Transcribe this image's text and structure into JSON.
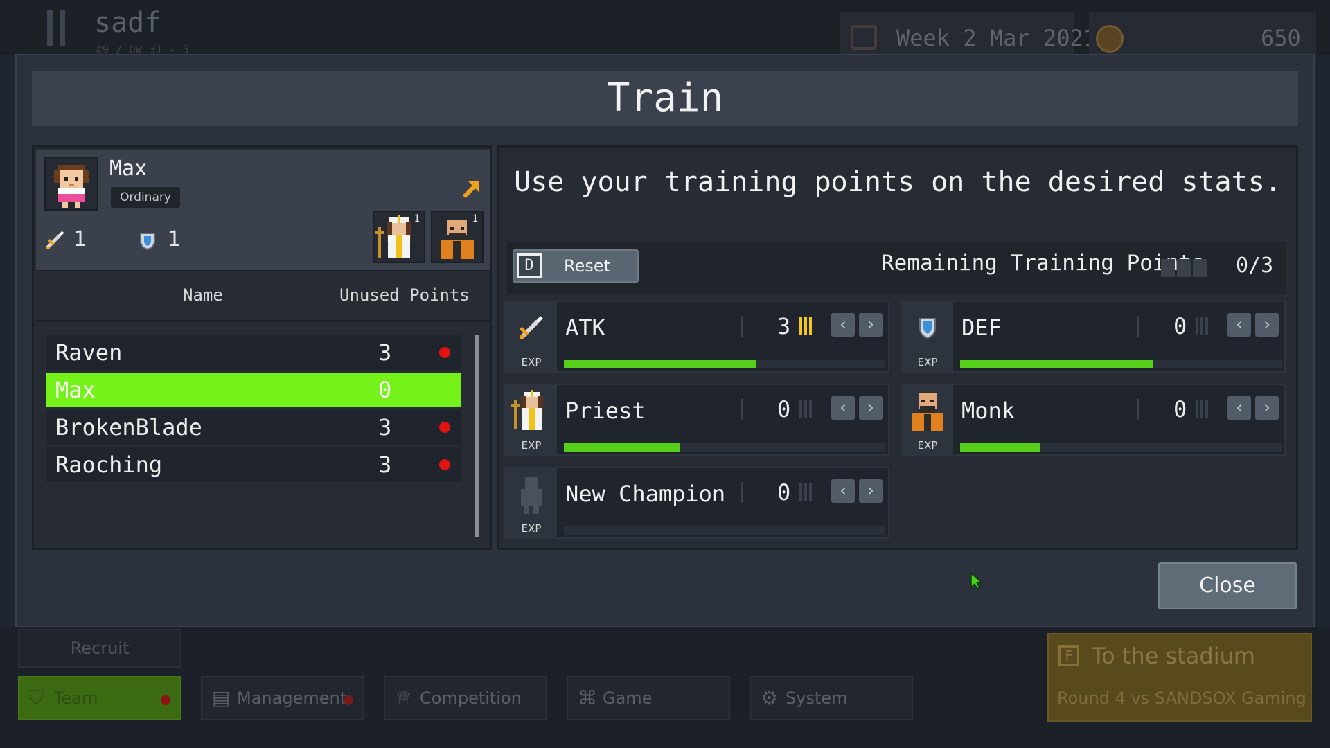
{
  "background": {
    "team_name": "sadf",
    "team_subtitle": "#9 / OW 31 - 5",
    "date": "Week 2 Mar 2021",
    "gold": "650",
    "recruit_label": "Recruit",
    "nav_tabs": [
      {
        "label": "Team",
        "icon": "shield-icon",
        "has_alert": true,
        "active": true
      },
      {
        "label": "Management",
        "icon": "document-icon",
        "has_alert": true,
        "active": false
      },
      {
        "label": "Competition",
        "icon": "trophy-icon",
        "has_alert": false,
        "active": false
      },
      {
        "label": "Game",
        "icon": "gamepad-icon",
        "has_alert": false,
        "active": false
      },
      {
        "label": "System",
        "icon": "gear-icon",
        "has_alert": false,
        "active": false
      }
    ],
    "stadium": {
      "key": "F",
      "title": "To the stadium",
      "subtitle": "Round 4 vs SANDSOX Gaming"
    }
  },
  "modal": {
    "title": "Train",
    "player": {
      "name": "Max",
      "rarity": "Ordinary",
      "atk": "1",
      "def": "1",
      "classes": [
        {
          "name": "Priest",
          "level": "1"
        },
        {
          "name": "Monk",
          "level": "1"
        }
      ]
    },
    "list_headers": {
      "name": "Name",
      "unused": "Unused Points"
    },
    "roster": [
      {
        "name": "Raven",
        "points": "3",
        "alert": true,
        "selected": false
      },
      {
        "name": "Max",
        "points": "0",
        "alert": false,
        "selected": true
      },
      {
        "name": "BrokenBlade",
        "points": "3",
        "alert": true,
        "selected": false
      },
      {
        "name": "Raoching",
        "points": "3",
        "alert": true,
        "selected": false
      }
    ],
    "instruction": "Use your training points on the desired stats.",
    "reset": {
      "key": "D",
      "label": "Reset"
    },
    "remaining": {
      "label": "Remaining Training Points",
      "value": "0/3"
    },
    "exp_label": "EXP",
    "stats": [
      {
        "name": "ATK",
        "value": "3",
        "pips_on": 3,
        "exp_progress": 0.6,
        "icon": "sword-icon"
      },
      {
        "name": "DEF",
        "value": "0",
        "pips_on": 0,
        "exp_progress": 0.6,
        "icon": "shield-icon"
      },
      {
        "name": "Priest",
        "value": "0",
        "pips_on": 0,
        "exp_progress": 0.36,
        "icon": "priest-icon"
      },
      {
        "name": "Monk",
        "value": "0",
        "pips_on": 0,
        "exp_progress": 0.25,
        "icon": "monk-icon"
      },
      {
        "name": "New Champion",
        "value": "0",
        "pips_on": 0,
        "exp_progress": 0,
        "icon": "champion-silhouette-icon"
      }
    ],
    "close_label": "Close"
  },
  "colors": {
    "accent_green": "#76f21b",
    "exp_fill": "#55cf1a",
    "alert_red": "#e01212",
    "pip_gold": "#f5c518"
  }
}
